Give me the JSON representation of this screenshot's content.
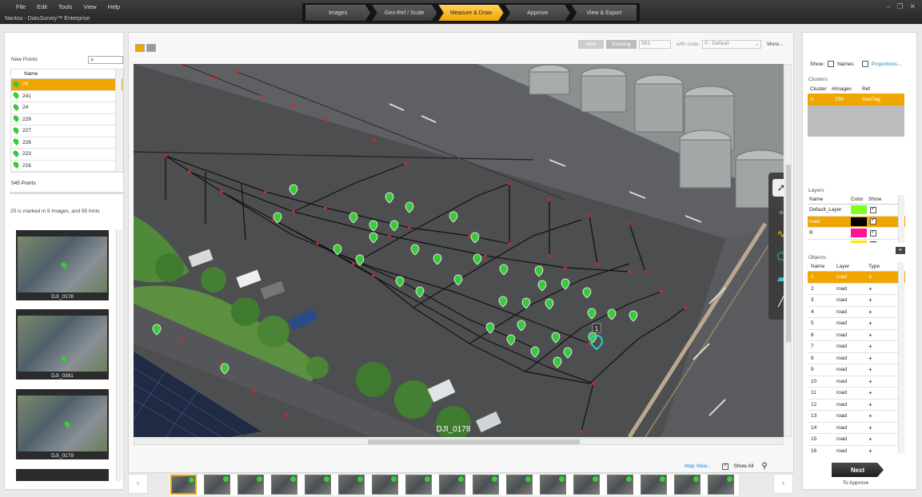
{
  "menu": [
    "File",
    "Edit",
    "Tools",
    "View",
    "Help"
  ],
  "app_title": "Nantou - DatuSurvey™ Enterprise",
  "steps": [
    {
      "label": "Images"
    },
    {
      "label": "Geo-Ref / Scale"
    },
    {
      "label": "Measure & Draw",
      "active": true
    },
    {
      "label": "Approve"
    },
    {
      "label": "View & Export"
    }
  ],
  "left": {
    "section_title": "New Points",
    "column_name": "Name",
    "points": [
      "25",
      "241",
      "24",
      "229",
      "227",
      "226",
      "223",
      "216"
    ],
    "points_count": "545 Points",
    "marked_info": "25 is marked in 9 Images, and 95 hints",
    "thumbnails": [
      "DJI_0178",
      "DJI_0391",
      "DJI_0179"
    ]
  },
  "center": {
    "btn_new": "New",
    "btn_existing": "Existing",
    "code_value": "561",
    "with_code_label": "with code:",
    "code_select": "0 - Default",
    "more_label": "More...",
    "image_label": "DJI_0178",
    "point_marker_label": "1",
    "map_view_link": "Map View...",
    "show_all_label": "Show All"
  },
  "right": {
    "show_label": "Show:",
    "names_label": "Names",
    "projections_link": "Projections...",
    "clusters_title": "Clusters",
    "clusters_headers": [
      "Cluster",
      "#Images",
      "Ref"
    ],
    "clusters": [
      {
        "cluster": "A",
        "images": "256",
        "ref": "GeoTag"
      }
    ],
    "layers_title": "Layers",
    "layers_headers": [
      "Name",
      "Color",
      "Show"
    ],
    "layers": [
      {
        "name": "Default_Layer",
        "color": "#7cff1e"
      },
      {
        "name": "road",
        "color": "#000000"
      },
      {
        "name": "R",
        "color": "#ff1493"
      },
      {
        "name": "",
        "color": "#ffe600"
      }
    ],
    "objects_title": "Objects",
    "objects_headers": [
      "Name",
      "Layer",
      "Type"
    ],
    "objects": [
      {
        "name": "1",
        "layer": "road"
      },
      {
        "name": "2",
        "layer": "road"
      },
      {
        "name": "3",
        "layer": "road"
      },
      {
        "name": "4",
        "layer": "road"
      },
      {
        "name": "5",
        "layer": "road"
      },
      {
        "name": "6",
        "layer": "road"
      },
      {
        "name": "7",
        "layer": "road"
      },
      {
        "name": "8",
        "layer": "road"
      },
      {
        "name": "9",
        "layer": "road"
      },
      {
        "name": "10",
        "layer": "road"
      },
      {
        "name": "11",
        "layer": "road"
      },
      {
        "name": "12",
        "layer": "road"
      },
      {
        "name": "13",
        "layer": "road"
      },
      {
        "name": "14",
        "layer": "road"
      },
      {
        "name": "15",
        "layer": "road"
      },
      {
        "name": "16",
        "layer": "road"
      }
    ],
    "next_button": "Next",
    "next_sub": "To Approve"
  },
  "colors": {
    "accent": "#f0a500",
    "point_green": "#3cc83c",
    "selected_point": "#22d3c8",
    "link": "#1a8ad4"
  },
  "icons": [
    "search-icon",
    "pointer-tool-icon",
    "point-tool-icon",
    "polyline-tool-icon",
    "polygon-tool-icon",
    "surface-tool-icon",
    "measure-line-tool-icon",
    "zoom-icon",
    "add-layer-icon"
  ]
}
